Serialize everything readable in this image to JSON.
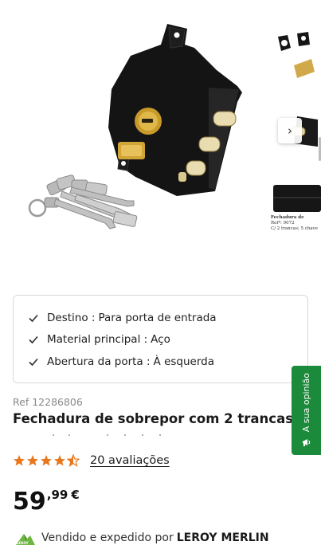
{
  "gallery": {
    "thumb_caption": {
      "line1": "Fechadura de",
      "line2": "Refª: 9072",
      "line3": "C/ 2 trancas; 5 chave"
    },
    "next_icon": "chevron-right-icon"
  },
  "features": {
    "items": [
      {
        "key": "Destino :",
        "value": "Para porta de entrada"
      },
      {
        "key": "Material principal :",
        "value": "Aço"
      },
      {
        "key": "Abertura da porta :",
        "value": "À esquerda"
      }
    ],
    "icon": "check-icon"
  },
  "product": {
    "ref_label": "Ref",
    "ref_number": "12286806",
    "title": "Fechadura de sobrepor com 2 trancas",
    "rating_value": 4.5,
    "rating_max": 5,
    "reviews_label": "20 avaliações",
    "price_int": "59",
    "price_cents": ",99",
    "price_currency": "€"
  },
  "seller": {
    "prefix": "Vendido e expedido por",
    "name": "LEROY MERLIN"
  },
  "feedback": {
    "label": "A sua opinião",
    "icon": "megaphone-icon"
  },
  "colors": {
    "star": "#e8771e",
    "feedback_bg": "#1b8a3a",
    "lock_body": "#141414",
    "brass": "#c79a2a"
  }
}
